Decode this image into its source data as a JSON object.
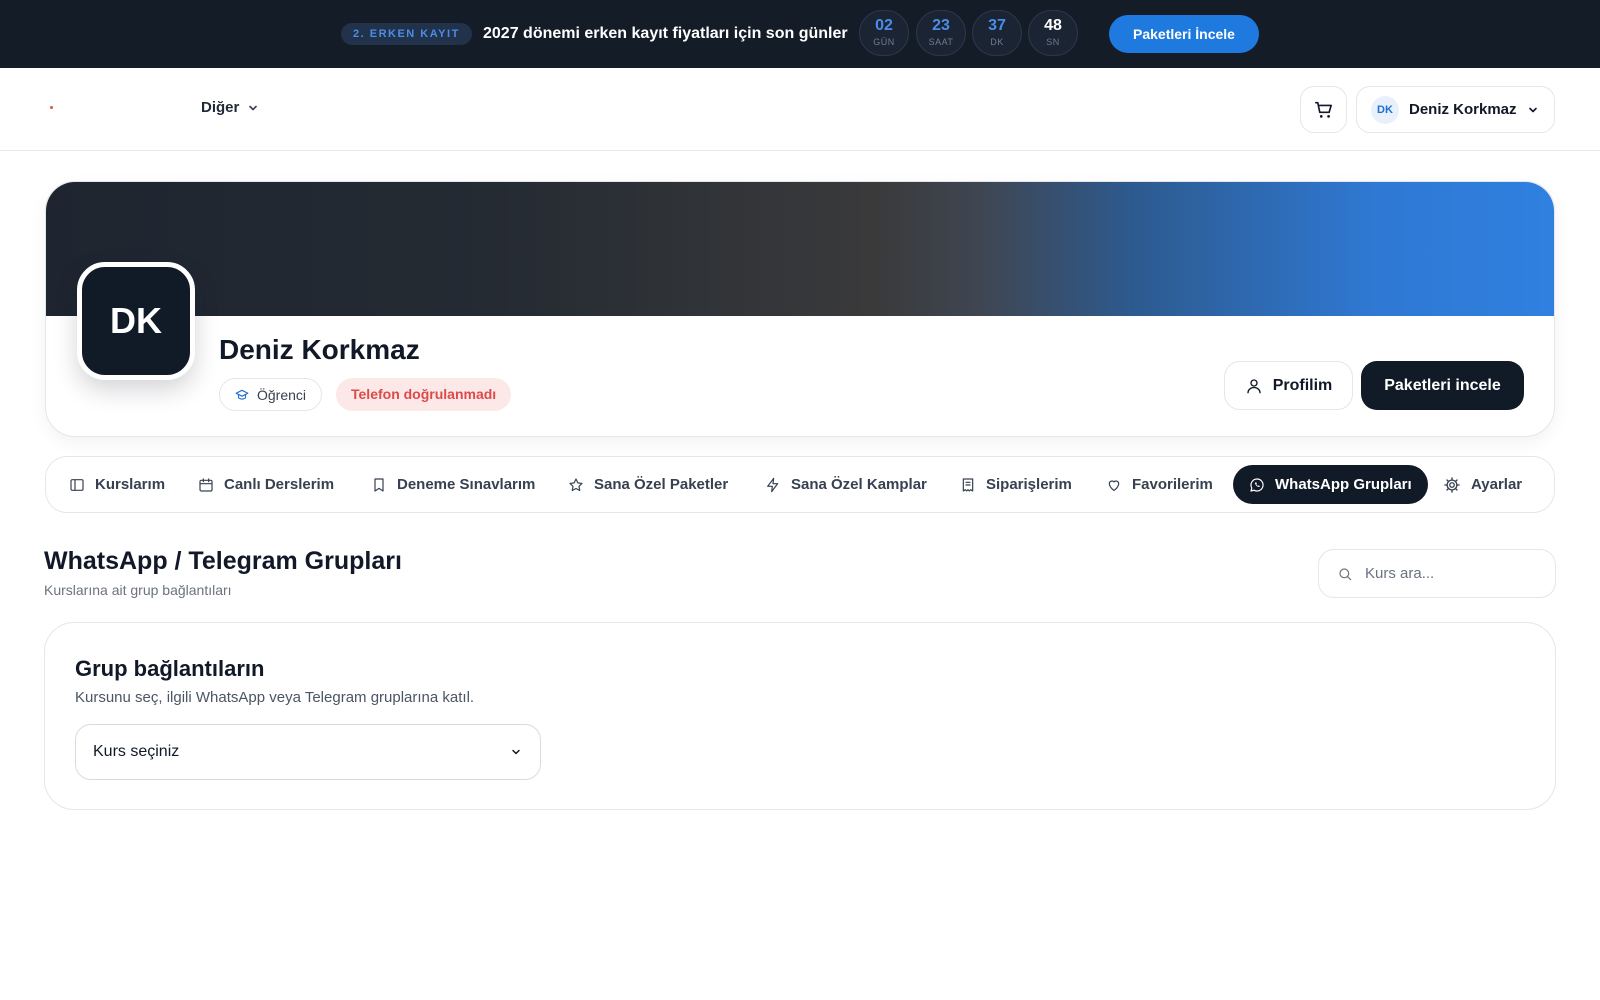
{
  "promo": {
    "badge": "2. ERKEN KAYIT",
    "text": "2027 dönemi erken kayıt fiyatları için son günler",
    "countdown": [
      {
        "value": "02",
        "label": "GÜN"
      },
      {
        "value": "23",
        "label": "SAAT"
      },
      {
        "value": "37",
        "label": "DK"
      },
      {
        "value": "48",
        "label": "SN"
      }
    ],
    "button": "Paketleri İncele"
  },
  "nav": {
    "menu_label": "Diğer",
    "user_initials": "DK",
    "user_name": "Deniz Korkmaz"
  },
  "profile": {
    "initials": "DK",
    "name": "Deniz Korkmaz",
    "role_tag": "Öğrenci",
    "phone_tag": "Telefon doğrulanmadı",
    "profile_button": "Profilim",
    "packages_button": "Paketleri incele"
  },
  "tabs": [
    {
      "label": "Kurslarım",
      "icon": "book-icon"
    },
    {
      "label": "Canlı Derslerim",
      "icon": "calendar-icon"
    },
    {
      "label": "Deneme Sınavlarım",
      "icon": "bookmark-icon"
    },
    {
      "label": "Sana Özel Paketler",
      "icon": "star-icon"
    },
    {
      "label": "Sana Özel Kamplar",
      "icon": "bolt-icon"
    },
    {
      "label": "Siparişlerim",
      "icon": "receipt-icon"
    },
    {
      "label": "Favorilerim",
      "icon": "heart-icon"
    },
    {
      "label": "WhatsApp Grupları",
      "icon": "whatsapp-icon",
      "active": true
    },
    {
      "label": "Ayarlar",
      "icon": "gear-icon"
    }
  ],
  "section": {
    "title": "WhatsApp / Telegram Grupları",
    "subtitle": "Kurslarına ait grup bağlantıları",
    "search_placeholder": "Kurs ara..."
  },
  "groups": {
    "title": "Grup bağlantıların",
    "subtitle": "Kursunu seç, ilgili WhatsApp veya Telegram gruplarına katıl.",
    "select_value": "Kurs seçiniz"
  },
  "colors": {
    "promo_bg": "#141c28",
    "accent_blue": "#1f7ae0",
    "dark": "#111a27",
    "danger": "#dc4a4a"
  }
}
